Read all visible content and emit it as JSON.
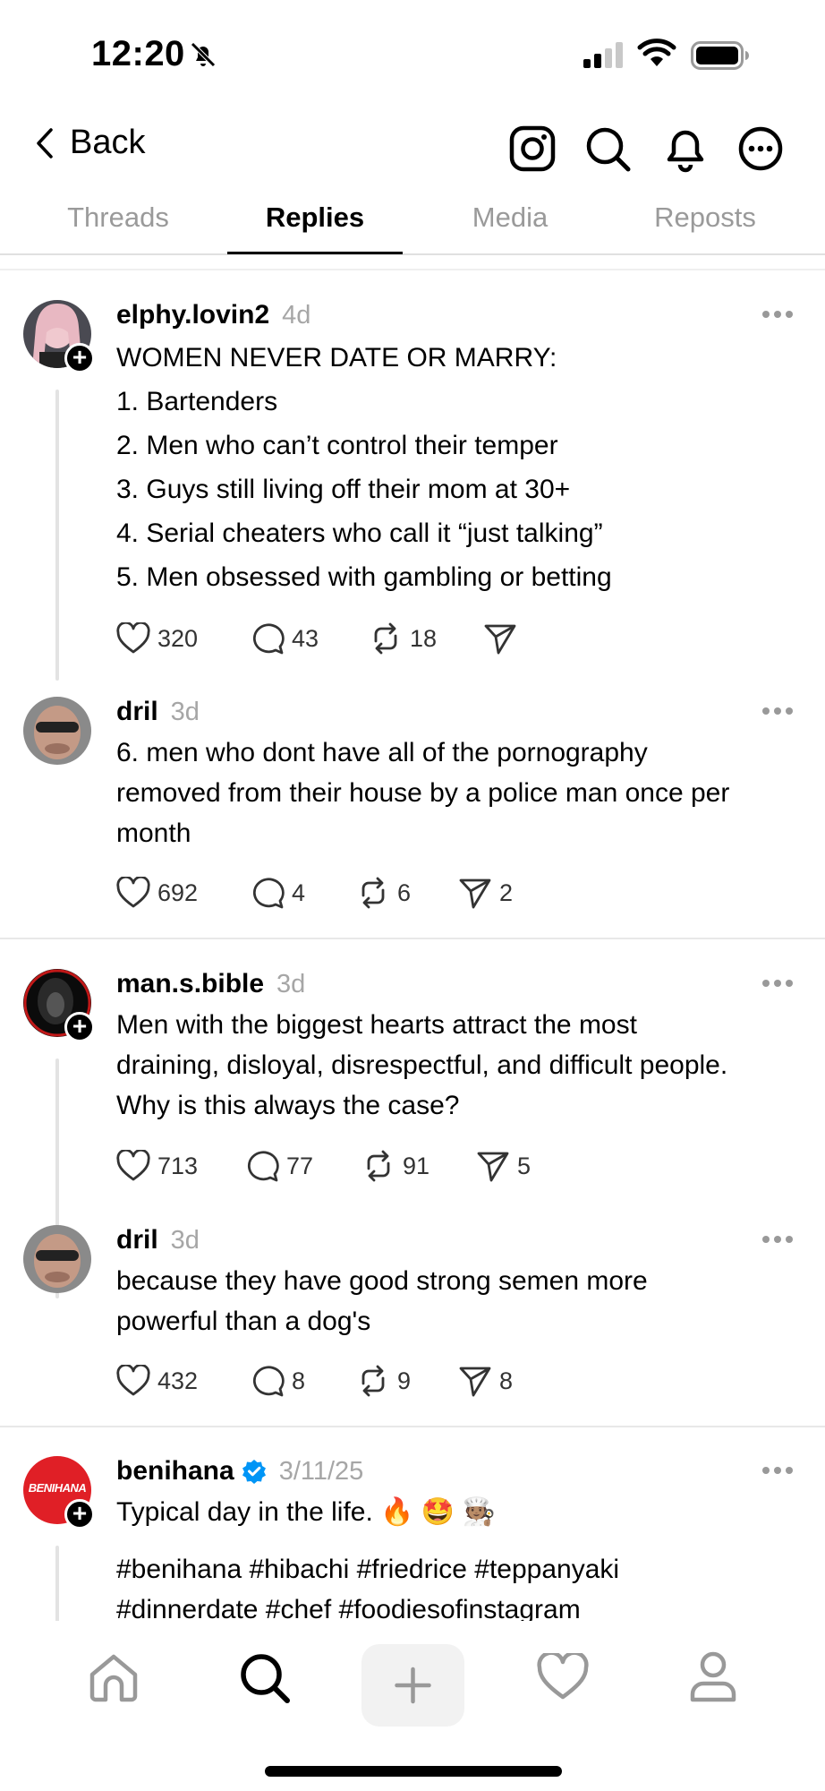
{
  "status_bar": {
    "time": "12:20"
  },
  "nav": {
    "back_label": "Back"
  },
  "tabs": [
    {
      "label": "Threads"
    },
    {
      "label": "Replies"
    },
    {
      "label": "Media"
    },
    {
      "label": "Reposts"
    }
  ],
  "posts": [
    {
      "username": "elphy.lovin2",
      "ago": "4d",
      "lines": [
        "WOMEN NEVER DATE OR MARRY:",
        "1. Bartenders",
        "2. Men who can’t control their temper",
        "3. Guys still living off their mom at 30+",
        "4. Serial cheaters who call it “just talking”",
        "5. Men obsessed with gambling or betting"
      ],
      "likes": "320",
      "comments": "43",
      "reposts": "18",
      "shares": ""
    },
    {
      "username": "dril",
      "ago": "3d",
      "lines": [
        "6. men who dont have all of the pornography",
        "removed from their house by a police man once per",
        "month"
      ],
      "likes": "692",
      "comments": "4",
      "reposts": "6",
      "shares": "2"
    },
    {
      "username": "man.s.bible",
      "ago": "3d",
      "lines": [
        "Men with the biggest hearts attract the most",
        "draining, disloyal, disrespectful, and difficult people.",
        "Why is this always the case?"
      ],
      "likes": "713",
      "comments": "77",
      "reposts": "91",
      "shares": "5"
    },
    {
      "username": "dril",
      "ago": "3d",
      "lines": [
        "because they have good strong semen more",
        "powerful than a dog's"
      ],
      "likes": "432",
      "comments": "8",
      "reposts": "9",
      "shares": "8"
    },
    {
      "username": "benihana",
      "ago": "3/11/25",
      "verified": true,
      "avatar_text": "BENIHANA",
      "lines": [
        "Typical day in the life. 🔥 🤩 🧑🏽‍🍳",
        "#benihana #hibachi #friedrice #teppanyaki",
        "#dinnerdate #chef #foodiesofinstagram"
      ]
    }
  ],
  "colors": {
    "accent": "#000000",
    "muted": "#9a9a9a",
    "verified": "#0095f6",
    "benihana_red": "#e01f26"
  },
  "icons": [
    "bell-slash-icon",
    "signal-icon",
    "wifi-icon",
    "battery-icon",
    "chevron-left-icon",
    "instagram-icon",
    "search-icon",
    "bell-icon",
    "more-circle-icon",
    "heart-icon",
    "comment-icon",
    "repost-icon",
    "share-icon",
    "home-icon",
    "plus-icon",
    "profile-icon",
    "verified-badge-icon"
  ]
}
